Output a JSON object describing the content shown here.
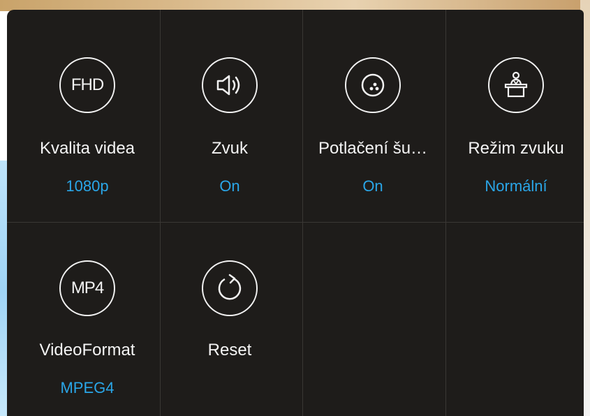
{
  "settings_panel": {
    "tiles": [
      {
        "label": "Kvalita videa",
        "value": "1080p",
        "icon": "fhd-icon",
        "icon_text": "FHD"
      },
      {
        "label": "Zvuk",
        "value": "On",
        "icon": "speaker-icon"
      },
      {
        "label": "Potlačení šu…",
        "value": "On",
        "icon": "noise-suppression-icon"
      },
      {
        "label": "Režim zvuku",
        "value": "Normální",
        "icon": "podium-speaker-icon"
      },
      {
        "label": "VideoFormat",
        "value": "MPEG4",
        "icon": "mp4-icon",
        "icon_text": "MP4"
      },
      {
        "label": "Reset",
        "value": "",
        "icon": "reset-icon"
      }
    ]
  },
  "colors": {
    "panel_background": "#1e1c1a",
    "divider": "#3a3734",
    "label_text": "#f4f4f4",
    "value_accent": "#2aa6e8",
    "icon_stroke": "#f2f2f2"
  }
}
